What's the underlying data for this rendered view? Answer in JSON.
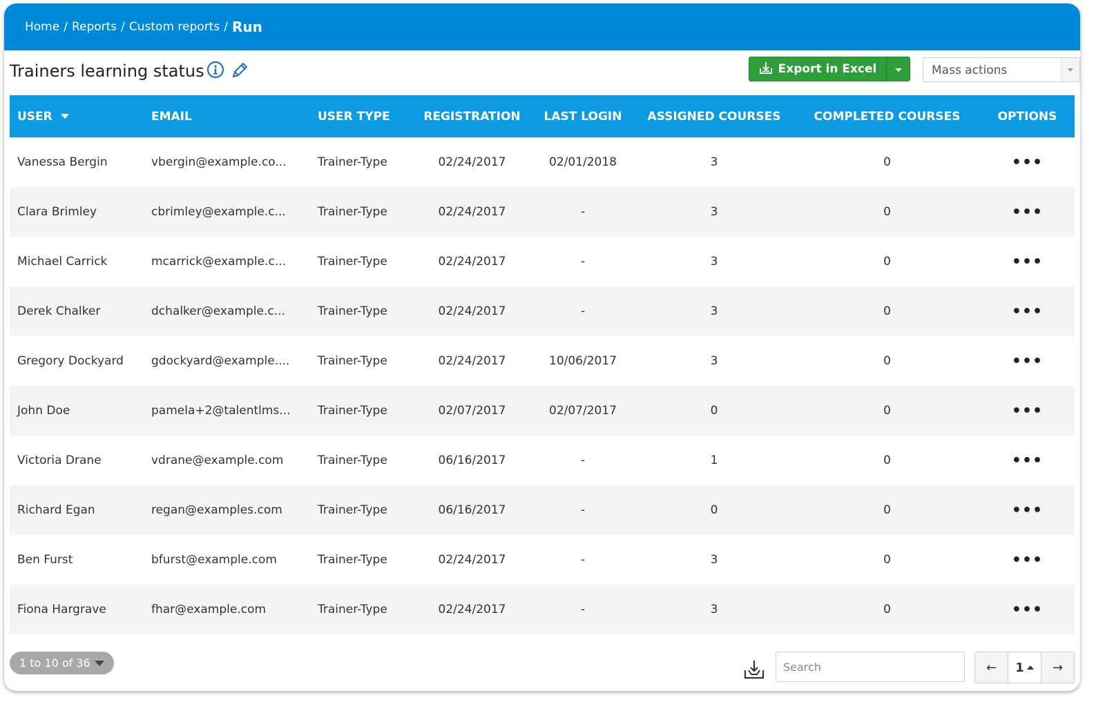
{
  "breadcrumb": {
    "items": [
      "Home",
      "Reports",
      "Custom reports"
    ],
    "current": "Run"
  },
  "page": {
    "title": "Trainers learning status"
  },
  "toolbar": {
    "export_label": "Export in Excel",
    "mass_actions": "Mass actions"
  },
  "table": {
    "columns": [
      "User",
      "Email",
      "User type",
      "Registration",
      "Last login",
      "Assigned courses",
      "Completed courses",
      "Options"
    ],
    "rows": [
      {
        "user": "Vanessa Bergin",
        "email": "vbergin@example.co...",
        "type": "Trainer-Type",
        "registration": "02/24/2017",
        "last_login": "02/01/2018",
        "assigned": "3",
        "completed": "0"
      },
      {
        "user": "Clara Brimley",
        "email": "cbrimley@example.c...",
        "type": "Trainer-Type",
        "registration": "02/24/2017",
        "last_login": "-",
        "assigned": "3",
        "completed": "0"
      },
      {
        "user": "Michael Carrick",
        "email": "mcarrick@example.c...",
        "type": "Trainer-Type",
        "registration": "02/24/2017",
        "last_login": "-",
        "assigned": "3",
        "completed": "0"
      },
      {
        "user": "Derek Chalker",
        "email": "dchalker@example.c...",
        "type": "Trainer-Type",
        "registration": "02/24/2017",
        "last_login": "-",
        "assigned": "3",
        "completed": "0"
      },
      {
        "user": "Gregory Dockyard",
        "email": "gdockyard@example....",
        "type": "Trainer-Type",
        "registration": "02/24/2017",
        "last_login": "10/06/2017",
        "assigned": "3",
        "completed": "0"
      },
      {
        "user": "John Doe",
        "email": "pamela+2@talentlms...",
        "type": "Trainer-Type",
        "registration": "02/07/2017",
        "last_login": "02/07/2017",
        "assigned": "0",
        "completed": "0"
      },
      {
        "user": "Victoria Drane",
        "email": "vdrane@example.com",
        "type": "Trainer-Type",
        "registration": "06/16/2017",
        "last_login": "-",
        "assigned": "1",
        "completed": "0"
      },
      {
        "user": "Richard Egan",
        "email": "regan@examples.com",
        "type": "Trainer-Type",
        "registration": "06/16/2017",
        "last_login": "-",
        "assigned": "0",
        "completed": "0"
      },
      {
        "user": "Ben Furst",
        "email": "bfurst@example.com",
        "type": "Trainer-Type",
        "registration": "02/24/2017",
        "last_login": "-",
        "assigned": "3",
        "completed": "0"
      },
      {
        "user": "Fiona Hargrave",
        "email": "fhar@example.com",
        "type": "Trainer-Type",
        "registration": "02/24/2017",
        "last_login": "-",
        "assigned": "3",
        "completed": "0"
      }
    ],
    "options_glyph": "•••"
  },
  "footer": {
    "range": "1 to 10 of 36",
    "search_placeholder": "Search",
    "prev": "←",
    "page": "1",
    "next": "→"
  },
  "colors": {
    "topbar": "#0089d6",
    "header": "#0c9ae0",
    "export": "#2e9e3b"
  },
  "icons": [
    "info-icon",
    "edit-pencil-icon",
    "export-download-icon",
    "caret-down-icon",
    "download-tray-icon"
  ]
}
